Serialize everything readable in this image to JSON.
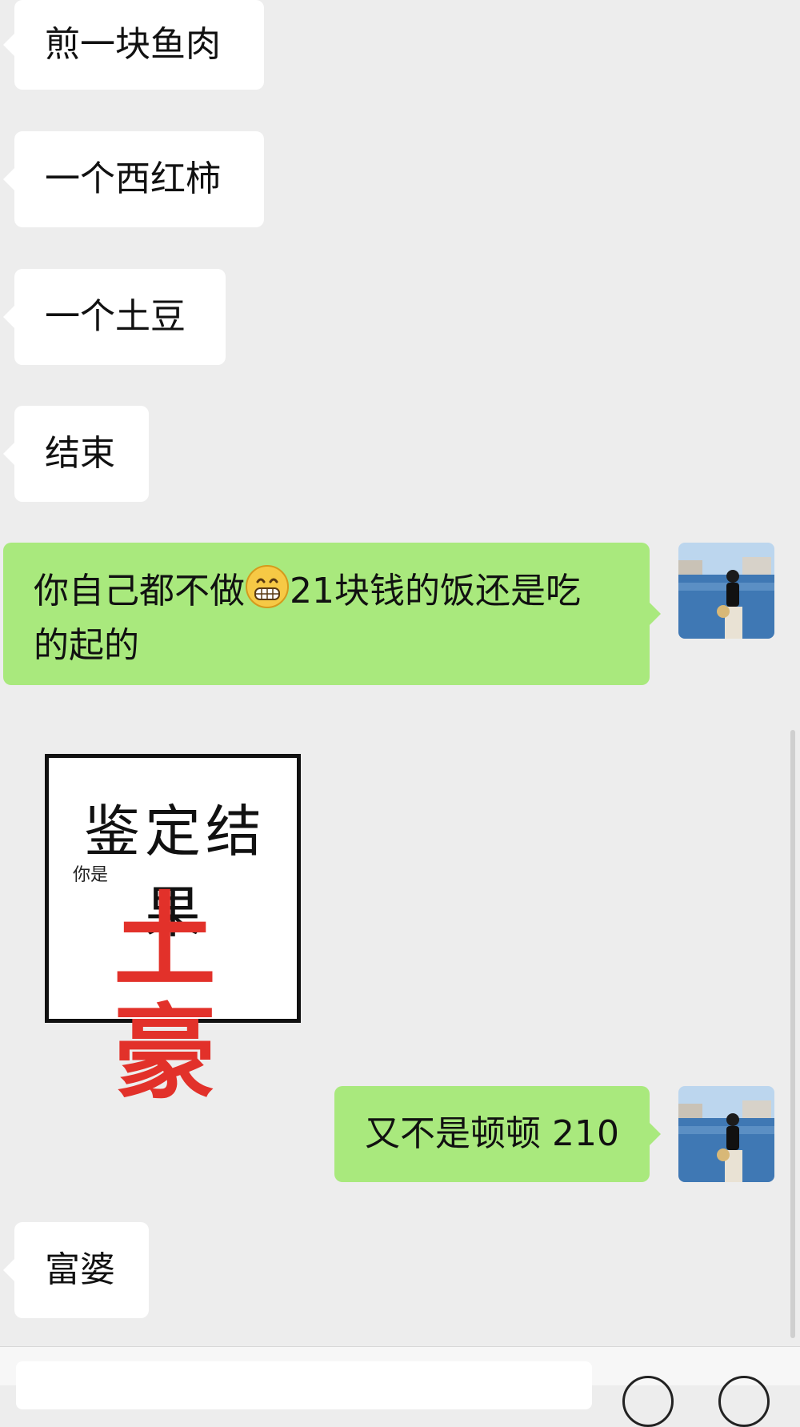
{
  "messages": [
    {
      "side": "in",
      "text": "煎一块鱼肉"
    },
    {
      "side": "in",
      "text": "一个西红柿"
    },
    {
      "side": "in",
      "text": "一个土豆"
    },
    {
      "side": "in",
      "text": "结束"
    },
    {
      "side": "out",
      "line1_before_emoji": "你自己都不做",
      "line1_after_emoji": "21块钱的饭还是吃",
      "line2": "的起的",
      "emoji": "grinning-face"
    },
    {
      "side": "in",
      "type": "sticker",
      "title": "鉴定结果",
      "small": "你是",
      "big": "土豪"
    },
    {
      "side": "out",
      "text": "又不是顿顿 210"
    },
    {
      "side": "in",
      "text": "富婆"
    }
  ],
  "colors": {
    "background": "#ededed",
    "incoming_bubble": "#ffffff",
    "outgoing_bubble": "#a9e97d",
    "sticker_red": "#e2312a"
  }
}
